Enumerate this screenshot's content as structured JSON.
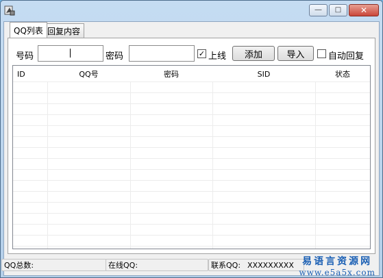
{
  "tabs": [
    {
      "label": "QQ列表"
    },
    {
      "label": "回复内容"
    }
  ],
  "form": {
    "account_label": "号码",
    "account_value": "",
    "password_label": "密码",
    "password_value": "",
    "online_label": "上线",
    "online_checked": true,
    "add_button": "添加",
    "import_button": "导入",
    "auto_reply_label": "自动回复",
    "auto_reply_checked": false
  },
  "grid": {
    "columns": [
      "ID",
      "QQ号",
      "密码",
      "SID",
      "状态"
    ],
    "rows": []
  },
  "statusbar": {
    "total_label": "QQ总数:",
    "total_value": "",
    "online_label": "在线QQ:",
    "online_value": "",
    "contact_label": "联系QQ:",
    "contact_value": "XXXXXXXXX"
  },
  "watermark": {
    "line1": "易语言资源网",
    "line2": "www.e5a5x.com"
  }
}
